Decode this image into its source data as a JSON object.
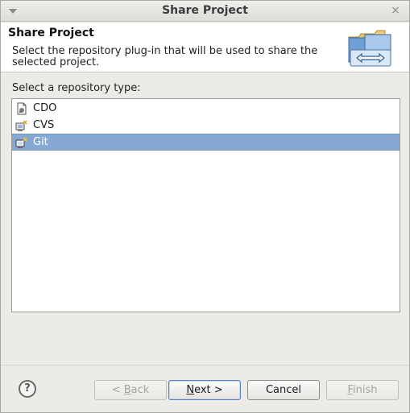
{
  "window": {
    "title": "Share Project",
    "menu_icon": "chevron-down-icon",
    "close_icon": "close-icon",
    "close_glyph": "×"
  },
  "banner": {
    "heading": "Share Project",
    "description": "Select the repository plug-in that will be used to share the selected project.",
    "icon": "share-project-wizard-icon"
  },
  "section": {
    "label": "Select a repository type:"
  },
  "repositories": {
    "items": [
      {
        "label": "CDO",
        "icon": "cdo-repository-icon",
        "selected": false
      },
      {
        "label": "CVS",
        "icon": "cvs-repository-icon",
        "selected": false
      },
      {
        "label": "Git",
        "icon": "git-repository-icon",
        "selected": true
      }
    ]
  },
  "buttons": {
    "help_glyph": "?",
    "back": {
      "prefix": "< ",
      "mnemonic": "B",
      "rest": "ack",
      "enabled": false
    },
    "next": {
      "mnemonic": "N",
      "rest": "ext >",
      "enabled": true
    },
    "cancel": {
      "label": "Cancel",
      "enabled": true
    },
    "finish": {
      "mnemonic": "F",
      "rest": "inish",
      "enabled": false
    }
  },
  "colors": {
    "selection": "#86a9d4",
    "dialog_background": "#ecebe8",
    "disabled_text": "#a5a4a0"
  }
}
